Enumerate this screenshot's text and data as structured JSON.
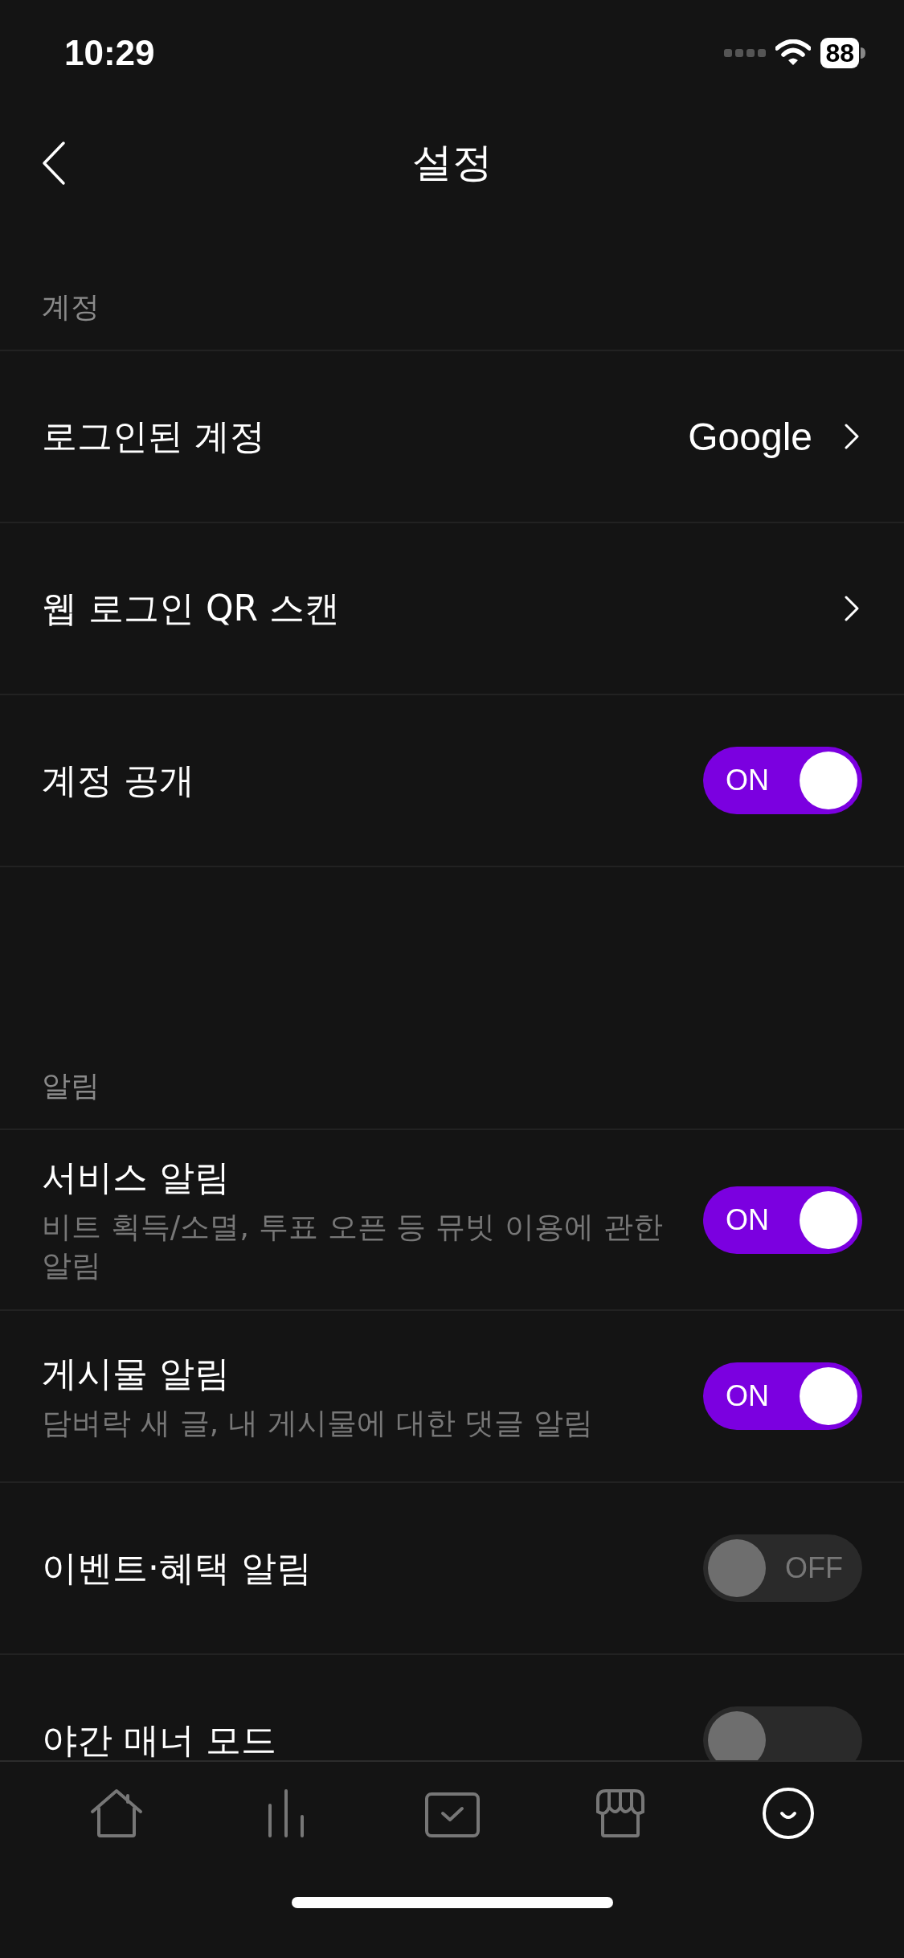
{
  "status_bar": {
    "time": "10:29",
    "battery": "88"
  },
  "header": {
    "title": "설정"
  },
  "sections": [
    {
      "title": "계정",
      "rows": [
        {
          "kind": "link",
          "label": "로그인된 계정",
          "value": "Google"
        },
        {
          "kind": "link",
          "label": "웹 로그인 QR 스캔"
        },
        {
          "kind": "toggle",
          "label": "계정 공개",
          "on": true,
          "state_label": "ON"
        }
      ]
    },
    {
      "title": "알림",
      "rows": [
        {
          "kind": "toggle",
          "label": "서비스 알림",
          "description": "비트 획득/소멸, 투표 오픈 등 뮤빗 이용에 관한 알림",
          "on": true,
          "state_label": "ON"
        },
        {
          "kind": "toggle",
          "label": "게시물 알림",
          "description": "담벼락 새 글, 내 게시물에 대한 댓글 알림",
          "on": true,
          "state_label": "ON"
        },
        {
          "kind": "toggle",
          "label": "이벤트·혜택 알림",
          "on": false,
          "state_label": "OFF"
        },
        {
          "kind": "toggle",
          "label": "야간 매너 모드",
          "on": false
        }
      ]
    }
  ],
  "tab_bar": {
    "items": [
      {
        "selected": false
      },
      {
        "selected": false
      },
      {
        "selected": false
      },
      {
        "selected": false
      },
      {
        "selected": true
      }
    ]
  }
}
